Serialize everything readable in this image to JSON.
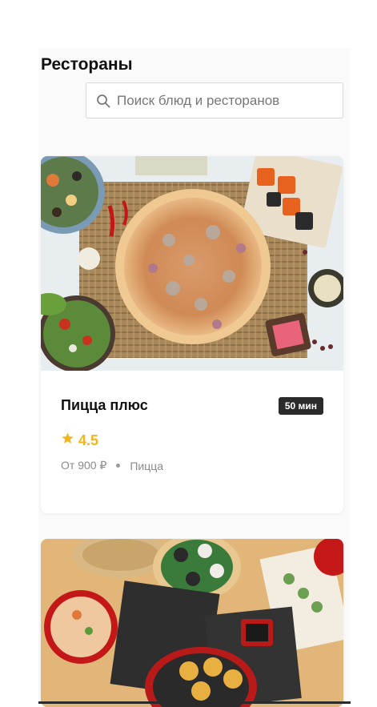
{
  "page": {
    "title": "Рестораны"
  },
  "search": {
    "placeholder": "Поиск блюд и ресторанов",
    "icon": "search-icon"
  },
  "restaurants": [
    {
      "name": "Пицца плюс",
      "delivery_time": "50 мин",
      "rating": "4.5",
      "price": "От 900 ₽",
      "cuisine": "Пицца",
      "image": "pizza-table-photo"
    },
    {
      "image": "asian-food-table-photo"
    }
  ],
  "colors": {
    "rating": "#f3b51a",
    "badge_bg": "#2b2b2b",
    "muted_text": "#8a8a8a",
    "background": "#fafafa"
  }
}
